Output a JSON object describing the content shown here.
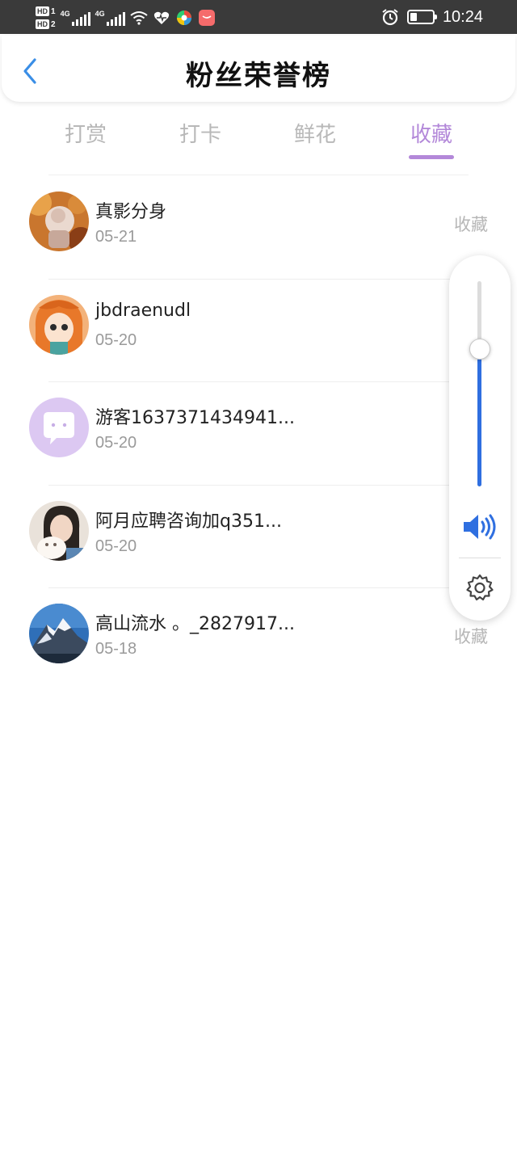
{
  "status_bar": {
    "hd1": "HD",
    "hd1_sub": "1",
    "hd2": "HD",
    "hd2_sub": "2",
    "network1": "4G",
    "network2": "4G",
    "time": "10:24",
    "icons": [
      "wifi-icon",
      "heart-rate-icon",
      "app-color-icon",
      "mail-app-icon",
      "alarm-icon",
      "battery-icon"
    ]
  },
  "header": {
    "title": "粉丝荣誉榜",
    "back_icon": "chevron-left-icon"
  },
  "tabs": [
    {
      "label": "打赏",
      "active": false
    },
    {
      "label": "打卡",
      "active": false
    },
    {
      "label": "鲜花",
      "active": false
    },
    {
      "label": "收藏",
      "active": true
    }
  ],
  "fans": [
    {
      "name": "真影分身",
      "date": "05-21",
      "action": "收藏",
      "avatar": "avatar-autumn-portrait"
    },
    {
      "name": "jbdraenudl",
      "date": "05-20",
      "action": "",
      "avatar": "avatar-orange-hair-girl"
    },
    {
      "name": "游客1637371434941...",
      "date": "05-20",
      "action": "",
      "avatar": "avatar-default-guest"
    },
    {
      "name": "阿月应聘咨询加q351...",
      "date": "05-20",
      "action": "",
      "avatar": "avatar-woman-with-cat"
    },
    {
      "name": "高山流水 。_2827917...",
      "date": "05-18",
      "action": "收藏",
      "avatar": "avatar-snow-mountain"
    }
  ],
  "volume_panel": {
    "level": 0.67,
    "speaker_icon": "speaker-icon",
    "settings_icon": "gear-icon"
  },
  "colors": {
    "accent": "#b388d9",
    "status_bar": "#3a3a3a",
    "back_arrow": "#3a8ee6",
    "volume": "#2f6fe0",
    "muted_text": "#9a9a9a"
  }
}
